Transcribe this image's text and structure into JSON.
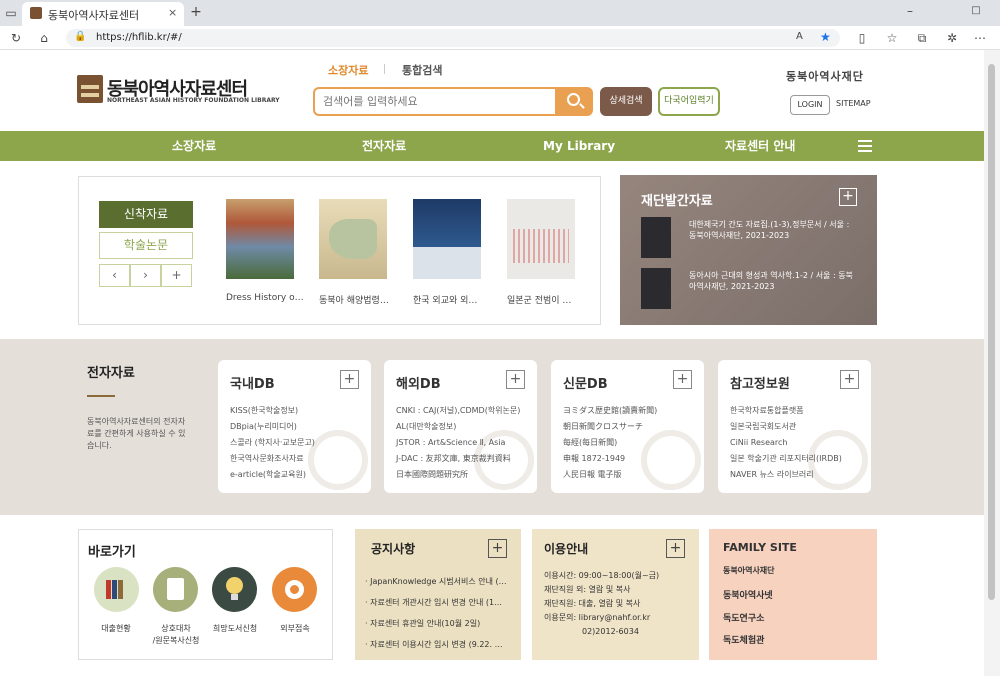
{
  "browser": {
    "tab_title": "동북아역사자료센터",
    "url": "https://hflib.kr/#/"
  },
  "header": {
    "logo_text": "동북아역사자료센터",
    "logo_subtext": "NORTHEAST ASIAN HISTORY FOUNDATION LIBRARY",
    "search_tabs": [
      "소장자료",
      "통합검색"
    ],
    "search_placeholder": "검색어를 입력하세요",
    "advanced_search": "상세검색",
    "multilingual_input": "다국어입력기",
    "foundation_name": "동북아역사재단",
    "login": "LOGIN",
    "sitemap": "SITEMAP"
  },
  "nav": [
    "소장자료",
    "전자자료",
    "My Library",
    "자료센터 안내"
  ],
  "new_books": {
    "tabs": [
      "신착자료",
      "학술논문"
    ],
    "controls": [
      "‹",
      "›",
      "+"
    ],
    "books": [
      {
        "title": "Dress History o…"
      },
      {
        "title": "동북아 해양법령…"
      },
      {
        "title": "한국 외교와 외…"
      },
      {
        "title": "일본군 전범이 …"
      }
    ]
  },
  "publications": {
    "title": "재단발간자료",
    "items": [
      "대한제국기 간도 자료집.(1-3),정부문서 / 서울 : 동북아역사재단, 2021-2023",
      "동아시아 근대의 형성과 역사학.1-2 / 서울 : 동북아역사재단, 2021-2023"
    ]
  },
  "e_resources": {
    "title": "전자자료",
    "description": "동북아역사자료센터의 전자자료를 간편하게 사용하실 수 있습니다.",
    "cards": [
      {
        "title": "국내DB",
        "items": [
          "KISS(한국학술정보)",
          "DBpia(누리미디어)",
          "스콜라 (학지사·교보문고)",
          "한국역사문화조사자료",
          "e-article(학술교육원)"
        ]
      },
      {
        "title": "해외DB",
        "items": [
          "CNKI : CAJ(저널),CDMD(학위논문)",
          "AL(대만학술정보)",
          "JSTOR : Art&Science Ⅱ, Asia",
          "J-DAC : 友邦文庫, 東京裁判資料",
          "日本國際問題研究所"
        ]
      },
      {
        "title": "신문DB",
        "items": [
          "ヨミダス歴史館(讀賣新聞)",
          "朝日新聞クロスサーチ",
          "每經(每日新聞)",
          "申報 1872-1949",
          "人民日報 電子版"
        ]
      },
      {
        "title": "참고정보원",
        "items": [
          "한국학자료통합플랫폼",
          "일본국립국회도서관",
          "CiNii Research",
          "일본 학술기관 리포지터리(IRDB)",
          "NAVER 뉴스 라이브러리"
        ]
      }
    ]
  },
  "quick_links": {
    "title": "바로가기",
    "items": [
      "대출현황",
      "상호대차\n/원문복사신청",
      "희망도서신청",
      "외부접속"
    ],
    "colors": [
      "#d9e2c2",
      "#a7b07a",
      "#3b4a43",
      "#e98a3a"
    ]
  },
  "notice": {
    "title": "공지사항",
    "items": [
      "JapanKnowledge 시범서비스 안내 (…",
      "자료센터 개관시간 임시 변경 안내 (1…",
      "자료센터 휴관일 안내(10월 2일)",
      "자료센터 이용시간 임시 변경 (9.22. …"
    ]
  },
  "usage": {
    "title": "이용안내",
    "rows": [
      "이용시간: 09:00~18:00(월~금)",
      "재단직원 외: 열람 및 복사",
      "재단직원: 대출, 열람 및 복사",
      "이용문의: library@nahf.or.kr",
      "02)2012-6034"
    ]
  },
  "family_site": {
    "title": "FAMILY SITE",
    "links": [
      "동북아역사재단",
      "동북아역사넷",
      "독도연구소",
      "독도체험관"
    ]
  }
}
